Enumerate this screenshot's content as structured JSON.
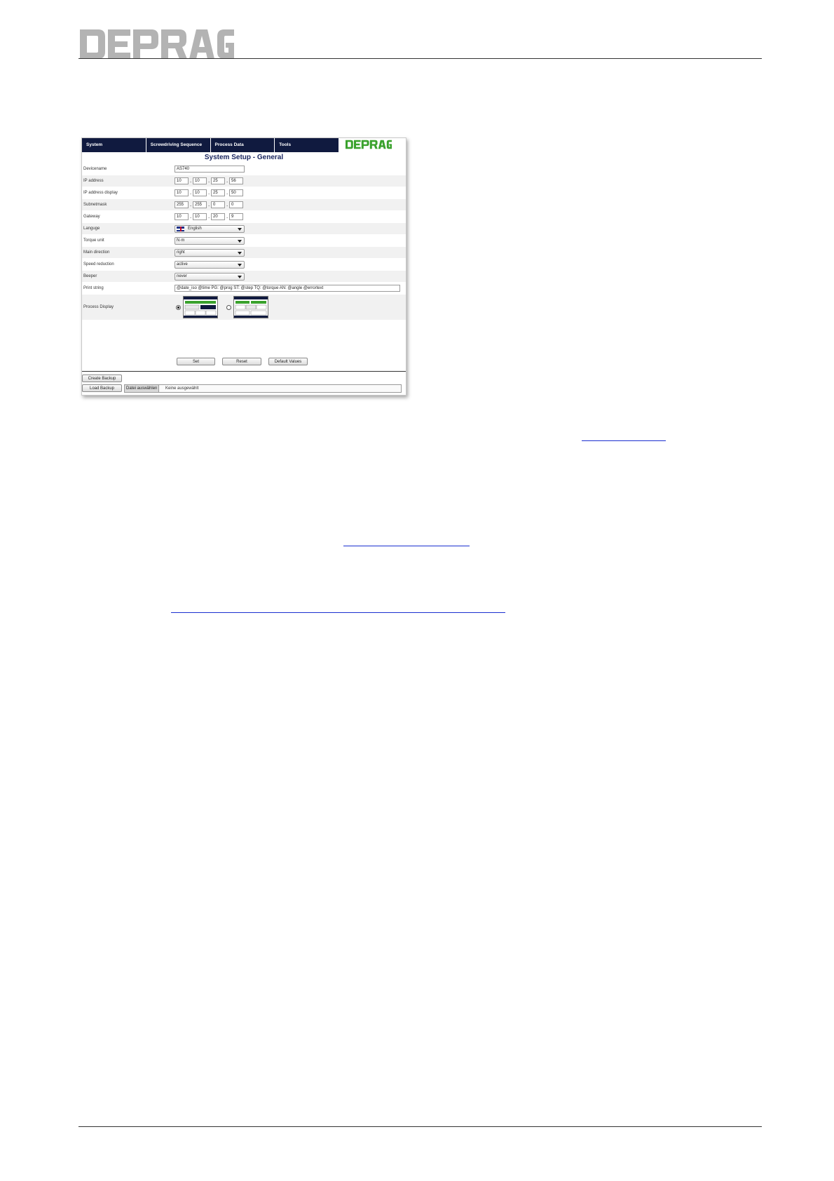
{
  "document": {
    "brand_color": "#b3b3b3",
    "link_color": "#1a2fd0"
  },
  "screenshot": {
    "nav": [
      {
        "label": "System"
      },
      {
        "label": "Screwdriving Sequence"
      },
      {
        "label": "Process Data"
      },
      {
        "label": "Tools"
      }
    ],
    "logo_color": "#3aa22d",
    "nav_color": "#101a3f",
    "title": "System Setup - General",
    "fields": {
      "devicename": {
        "label": "Devicename",
        "value": "AS740"
      },
      "ip_address": {
        "label": "IP address",
        "octets": [
          "10",
          "10",
          "25",
          "56"
        ]
      },
      "ip_display": {
        "label": "IP address display",
        "octets": [
          "10",
          "10",
          "25",
          "50"
        ]
      },
      "subnetmask": {
        "label": "Subnetmask",
        "octets": [
          "255",
          "255",
          "0",
          "0"
        ]
      },
      "gateway": {
        "label": "Gateway",
        "octets": [
          "10",
          "10",
          "20",
          "9"
        ]
      },
      "language": {
        "label": "Languge",
        "value": "English"
      },
      "torque_unit": {
        "label": "Torque unit",
        "value": "N·m"
      },
      "main_direction": {
        "label": "Main direction",
        "value": "right"
      },
      "speed_reduction": {
        "label": "Speed reduction",
        "value": "active"
      },
      "beeper": {
        "label": "Beeper",
        "value": "never"
      },
      "print_string": {
        "label": "Print string",
        "value": "@date_iso @time PG: @prog ST: @step TQ: @torque AN: @angle @errortext"
      },
      "process_display": {
        "label": "Process Display",
        "selected": 1
      }
    },
    "buttons": {
      "set": "Set",
      "reset": "Reset",
      "defaults": "Default Values",
      "create_backup": "Create Backup",
      "load_backup": "Load Backup"
    },
    "file_input": {
      "button": "Datei auswählen",
      "status": "Keine ausgewählt"
    }
  }
}
